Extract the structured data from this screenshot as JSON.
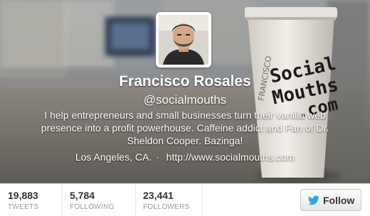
{
  "profile": {
    "name": "Francisco Rosales",
    "handle": "@socialmouths",
    "bio": "I help entrepreneurs and small businesses turn their vanilla web presence into a profit powerhouse. Caffeine addict and Fan of Dr. Sheldon Cooper. Bazinga!",
    "location": "Los Angeles, CA.",
    "separator": "·",
    "url": "http://www.socialmouths.com"
  },
  "stats": [
    {
      "value": "19,883",
      "label": "TWEETS"
    },
    {
      "value": "5,784",
      "label": "FOLLOWING"
    },
    {
      "value": "23,441",
      "label": "FOLLOWERS"
    }
  ],
  "follow_button": {
    "label": "Follow",
    "icon": "twitter-bird-icon"
  },
  "colors": {
    "bird": "#2aa9e0",
    "stat_label": "#999999",
    "text": "#333333"
  },
  "header_photo": {
    "cup_text_lines": [
      "Social",
      "Mouths",
      ".com"
    ],
    "cup_side_text": "FRANCISCO"
  }
}
